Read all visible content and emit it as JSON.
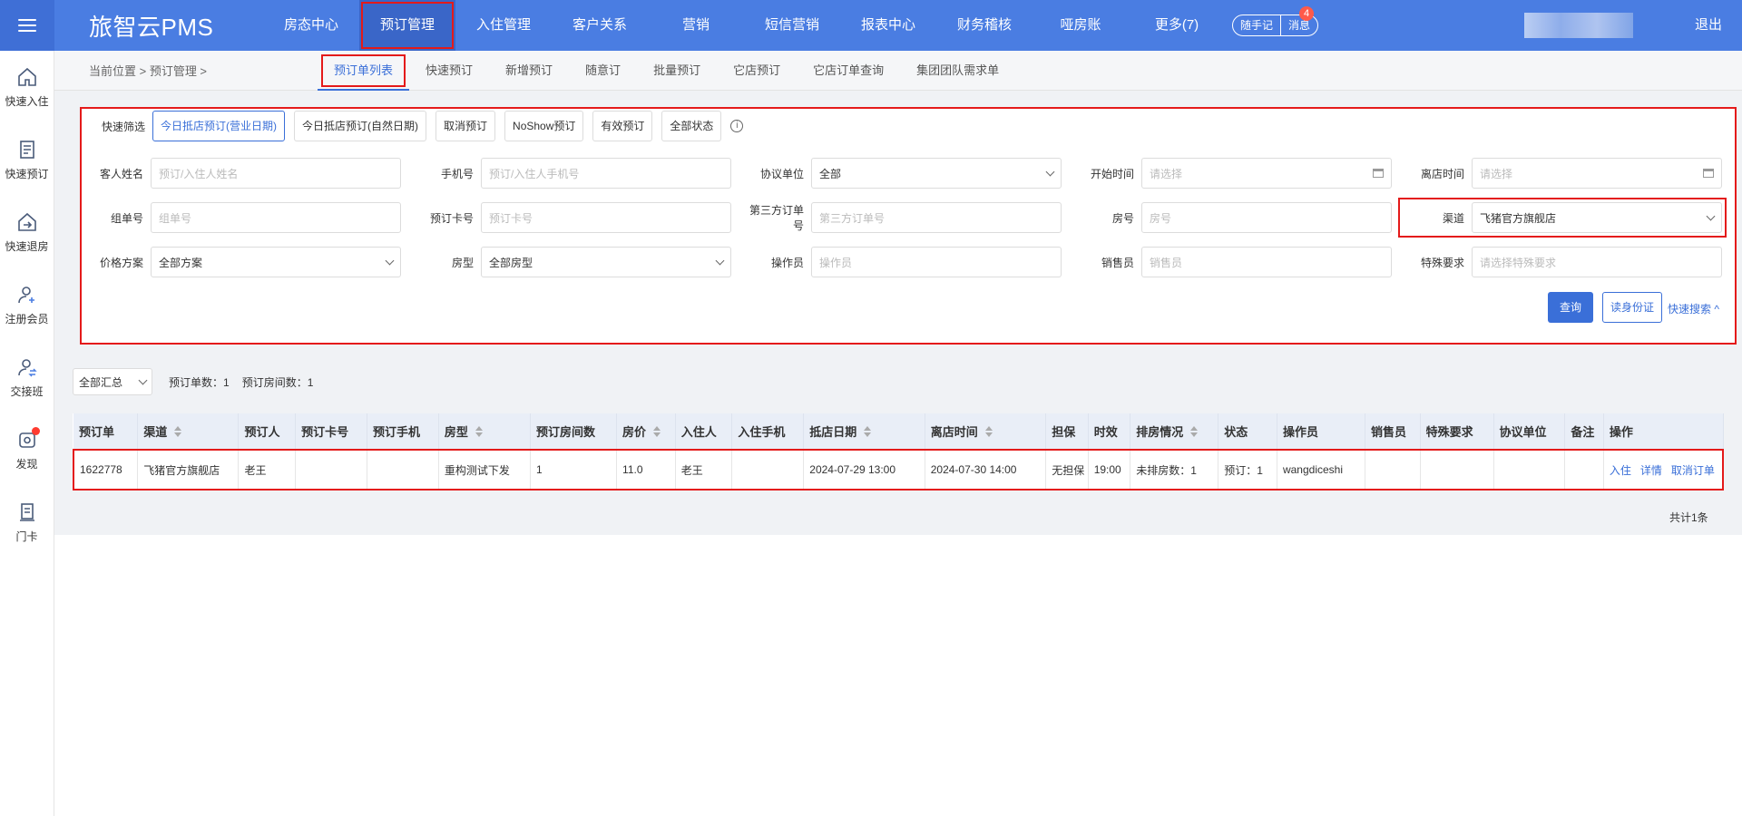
{
  "app": {
    "brand": "旅智云PMS",
    "logout": "退出"
  },
  "nav": [
    {
      "label": "房态中心"
    },
    {
      "label": "预订管理"
    },
    {
      "label": "入住管理"
    },
    {
      "label": "客户关系"
    },
    {
      "label": "营销"
    },
    {
      "label": "短信营销"
    },
    {
      "label": "报表中心"
    },
    {
      "label": "财务稽核"
    },
    {
      "label": "哑房账"
    },
    {
      "label": "更多(7)"
    }
  ],
  "pills": {
    "notes": "随手记",
    "messages": "消息",
    "message_count": "4"
  },
  "sidebar": [
    {
      "label": "快速入住"
    },
    {
      "label": "快速预订"
    },
    {
      "label": "快速退房"
    },
    {
      "label": "注册会员"
    },
    {
      "label": "交接班"
    },
    {
      "label": "发现"
    },
    {
      "label": "门卡"
    }
  ],
  "breadcrumb": "当前位置 > 预订管理 >",
  "subtabs": [
    {
      "label": "预订单列表"
    },
    {
      "label": "快速预订"
    },
    {
      "label": "新增预订"
    },
    {
      "label": "随意订"
    },
    {
      "label": "批量预订"
    },
    {
      "label": "它店预订"
    },
    {
      "label": "它店订单查询"
    },
    {
      "label": "集团团队需求单"
    }
  ],
  "quick_filter": {
    "label": "快速筛选",
    "buttons": [
      {
        "label": "今日抵店预订(营业日期)"
      },
      {
        "label": "今日抵店预订(自然日期)"
      },
      {
        "label": "取消预订"
      },
      {
        "label": "NoShow预订"
      },
      {
        "label": "有效预订"
      },
      {
        "label": "全部状态"
      }
    ],
    "info": "i"
  },
  "filters": {
    "guest_name": {
      "label": "客人姓名",
      "placeholder": "预订/入住人姓名"
    },
    "phone": {
      "label": "手机号",
      "placeholder": "预订/入住人手机号"
    },
    "agreement": {
      "label": "协议单位",
      "value": "全部"
    },
    "start_time": {
      "label": "开始时间",
      "placeholder": "请选择"
    },
    "leave_time": {
      "label": "离店时间",
      "placeholder": "请选择"
    },
    "group_no": {
      "label": "组单号",
      "placeholder": "组单号"
    },
    "card_no": {
      "label": "预订卡号",
      "placeholder": "预订卡号"
    },
    "third_order": {
      "label": "第三方订单号",
      "placeholder": "第三方订单号"
    },
    "room_no": {
      "label": "房号",
      "placeholder": "房号"
    },
    "channel": {
      "label": "渠道",
      "value": "飞猪官方旗舰店"
    },
    "price_plan": {
      "label": "价格方案",
      "value": "全部方案"
    },
    "room_type": {
      "label": "房型",
      "value": "全部房型"
    },
    "operator": {
      "label": "操作员",
      "placeholder": "操作员"
    },
    "sales": {
      "label": "销售员",
      "placeholder": "销售员"
    },
    "special": {
      "label": "特殊要求",
      "placeholder": "请选择特殊要求"
    }
  },
  "actions": {
    "query": "查询",
    "read_id": "读身份证",
    "quick_search": "快速搜索 ^"
  },
  "summary": {
    "select": "全部汇总",
    "order_count": "预订单数：1",
    "room_count": "预订房间数：1"
  },
  "table": {
    "headers": [
      "预订单",
      "渠道",
      "预订人",
      "预订卡号",
      "预订手机",
      "房型",
      "预订房间数",
      "房价",
      "入住人",
      "入住手机",
      "抵店日期",
      "离店时间",
      "担保",
      "时效",
      "排房情况",
      "状态",
      "操作员",
      "销售员",
      "特殊要求",
      "协议单位",
      "备注",
      "操作"
    ],
    "rows": [
      {
        "order": "1622778",
        "channel": "飞猪官方旗舰店",
        "booker": "老王",
        "card": "",
        "mobile": "",
        "room_type": "重构测试下发",
        "rooms": "1",
        "price": "11.0",
        "guest": "老王",
        "guest_mobile": "",
        "arrive": "2024-07-29 13:00",
        "leave": "2024-07-30 14:00",
        "guarantee": "无担保",
        "timeliness": "19:00",
        "assign": "未排房数：1",
        "status": "预订：1",
        "operator": "wangdiceshi",
        "sales": "",
        "special": "",
        "agreement": "",
        "remark": "",
        "ops": [
          "入住",
          "详情",
          "取消订单"
        ]
      }
    ],
    "total": "共计1条"
  }
}
